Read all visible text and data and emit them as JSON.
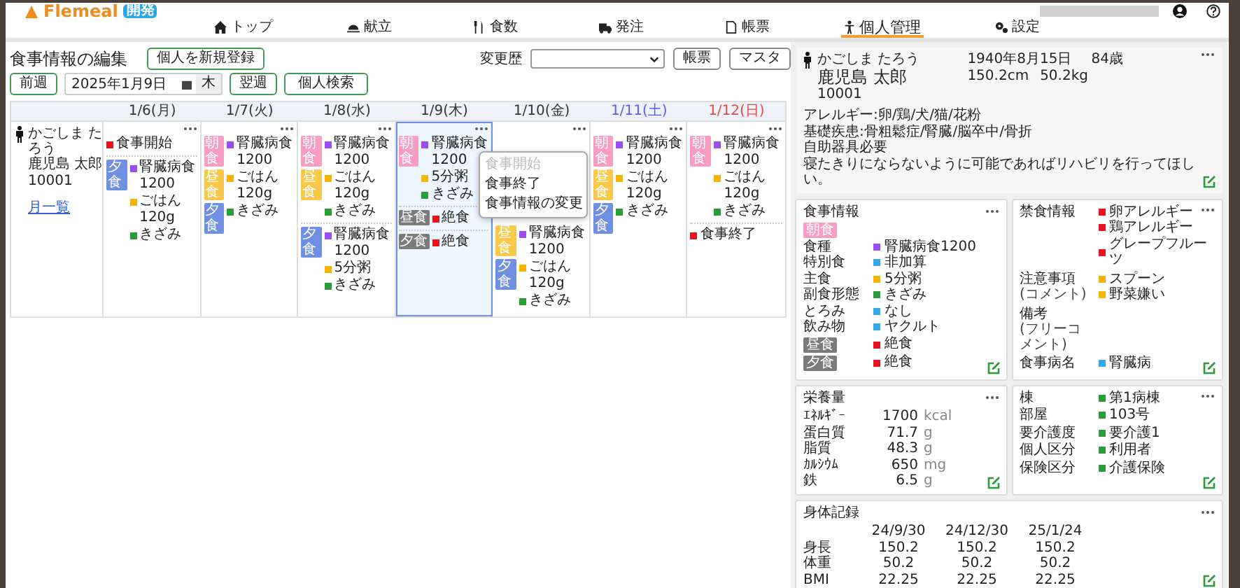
{
  "app": {
    "logo": "Flemeal",
    "env_badge": "開発"
  },
  "nav": [
    {
      "label": "トップ",
      "selected": false
    },
    {
      "label": "献立",
      "selected": false
    },
    {
      "label": "食数",
      "selected": false
    },
    {
      "label": "発注",
      "selected": false
    },
    {
      "label": "帳票",
      "selected": false
    },
    {
      "label": "個人管理",
      "selected": true
    },
    {
      "label": "設定",
      "selected": false
    }
  ],
  "toolbar": {
    "title": "食事情報の編集",
    "register_button": "個人を新規登録",
    "history_label": "変更歴",
    "report_button": "帳票",
    "master_button": "マスタ",
    "prev_week": "前週",
    "date": "2025年1月9日",
    "weekday": "木",
    "next_week": "翌週",
    "search_button": "個人検索"
  },
  "calendar": {
    "person": {
      "kana": "かごしま たろう",
      "name": "鹿児島 太郎",
      "id": "10001",
      "link": "月一覧"
    },
    "days": [
      {
        "date": "1/6(月)",
        "kind": "weekday",
        "selected": false,
        "sections": [
          {
            "items": [
              {
                "text": "食事開始",
                "color": "#e8141e"
              }
            ]
          },
          {
            "badges": [
              {
                "label": "夕食",
                "kind": "dinner"
              }
            ],
            "items": [
              {
                "text": "腎臓病食1200",
                "color": "#9b4df0"
              },
              {
                "text": "ごはん120g",
                "color": "#f5b400"
              },
              {
                "text": "きざみ",
                "color": "#2a9d3a"
              }
            ]
          }
        ]
      },
      {
        "date": "1/7(火)",
        "kind": "weekday",
        "selected": false,
        "sections": [
          {
            "badges": [
              {
                "label": "朝食",
                "kind": "breakfast"
              },
              {
                "label": "昼食",
                "kind": "lunch"
              },
              {
                "label": "夕食",
                "kind": "dinner"
              }
            ],
            "items": [
              {
                "text": "腎臓病食1200",
                "color": "#9b4df0"
              },
              {
                "text": "ごはん120g",
                "color": "#f5b400"
              },
              {
                "text": "きざみ",
                "color": "#2a9d3a"
              }
            ]
          }
        ]
      },
      {
        "date": "1/8(水)",
        "kind": "weekday",
        "selected": false,
        "sections": [
          {
            "badges": [
              {
                "label": "朝食",
                "kind": "breakfast"
              },
              {
                "label": "昼食",
                "kind": "lunch"
              }
            ],
            "items": [
              {
                "text": "腎臓病食1200",
                "color": "#9b4df0"
              },
              {
                "text": "ごはん120g",
                "color": "#f5b400"
              },
              {
                "text": "きざみ",
                "color": "#2a9d3a"
              }
            ]
          },
          {
            "badges": [
              {
                "label": "夕食",
                "kind": "dinner"
              }
            ],
            "items": [
              {
                "text": "腎臓病食1200",
                "color": "#9b4df0"
              },
              {
                "text": "5分粥",
                "color": "#f5b400"
              },
              {
                "text": "きざみ",
                "color": "#2a9d3a"
              }
            ]
          }
        ]
      },
      {
        "date": "1/9(木)",
        "kind": "weekday",
        "selected": true,
        "menu": [
          {
            "label": "食事開始",
            "disabled": true
          },
          {
            "label": "食事終了",
            "disabled": false
          },
          {
            "label": "食事情報の変更",
            "disabled": false
          }
        ],
        "sections": [
          {
            "badges": [
              {
                "label": "朝食",
                "kind": "breakfast"
              }
            ],
            "items": [
              {
                "text": "腎臓病食1200",
                "color": "#9b4df0"
              },
              {
                "text": "5分粥",
                "color": "#f5b400"
              },
              {
                "text": "きざみ",
                "color": "#2a9d3a"
              }
            ]
          },
          {
            "badges": [
              {
                "label": "昼食",
                "kind": "fasting"
              }
            ],
            "items": [
              {
                "text": "絶食",
                "color": "#e8141e"
              }
            ]
          },
          {
            "badges": [
              {
                "label": "夕食",
                "kind": "fasting"
              }
            ],
            "items": [
              {
                "text": "絶食",
                "color": "#e8141e"
              }
            ]
          }
        ]
      },
      {
        "date": "1/10(金)",
        "kind": "weekday",
        "selected": false,
        "sections": [
          {
            "badges": [
              {
                "label": "昼食",
                "kind": "lunch"
              },
              {
                "label": "夕食",
                "kind": "dinner"
              }
            ],
            "items": [
              {
                "text": "腎臓病食1200",
                "color": "#9b4df0"
              },
              {
                "text": "ごはん120g",
                "color": "#f5b400"
              },
              {
                "text": "きざみ",
                "color": "#2a9d3a"
              }
            ]
          }
        ]
      },
      {
        "date": "1/11(土)",
        "kind": "saturday",
        "selected": false,
        "sections": [
          {
            "badges": [
              {
                "label": "朝食",
                "kind": "breakfast"
              },
              {
                "label": "昼食",
                "kind": "lunch"
              },
              {
                "label": "夕食",
                "kind": "dinner"
              }
            ],
            "items": [
              {
                "text": "腎臓病食1200",
                "color": "#9b4df0"
              },
              {
                "text": "ごはん120g",
                "color": "#f5b400"
              },
              {
                "text": "きざみ",
                "color": "#2a9d3a"
              }
            ]
          }
        ]
      },
      {
        "date": "1/12(日)",
        "kind": "sunday",
        "selected": false,
        "sections": [
          {
            "badges": [
              {
                "label": "朝食",
                "kind": "breakfast"
              }
            ],
            "items": [
              {
                "text": "腎臓病食1200",
                "color": "#9b4df0"
              },
              {
                "text": "ごはん120g",
                "color": "#f5b400"
              },
              {
                "text": "きざみ",
                "color": "#2a9d3a"
              }
            ]
          },
          {
            "items": [
              {
                "text": "食事終了",
                "color": "#e8141e"
              }
            ]
          }
        ]
      }
    ]
  },
  "profile": {
    "kana": "かごしま たろう",
    "name": "鹿児島 太郎",
    "id": "10001",
    "birth": "1940年8月15日",
    "age": "84歳",
    "height": "150.2cm",
    "weight": "50.2kg",
    "notes": [
      "アレルギー:卵/鶏/犬/猫/花粉",
      "基礎疾患:骨粗鬆症/腎臓/脳卒中/骨折",
      "自助器具必要",
      "寝たきりにならないように可能であればリハビリを行ってほしい。"
    ]
  },
  "meal_info": {
    "title": "食事情報",
    "badge": {
      "label": "朝食",
      "kind": "breakfast"
    },
    "rows": [
      {
        "label": "食種",
        "value": "腎臓病食1200",
        "color": "#9b4df0"
      },
      {
        "label": "特別食",
        "value": "非加算",
        "color": "#35a9e8"
      },
      {
        "label": "主食",
        "value": "5分粥",
        "color": "#f5b400"
      },
      {
        "label": "副食形態",
        "value": "きざみ",
        "color": "#2a9d3a"
      },
      {
        "label": "とろみ",
        "value": "なし",
        "color": "#35a9e8"
      },
      {
        "label": "飲み物",
        "value": "ヤクルト",
        "color": "#35a9e8"
      }
    ],
    "meal_rows": [
      {
        "badge": {
          "label": "昼食",
          "kind": "fasting"
        },
        "value": "絶食",
        "color": "#e8141e"
      },
      {
        "badge": {
          "label": "夕食",
          "kind": "fasting"
        },
        "value": "絶食",
        "color": "#e8141e"
      }
    ]
  },
  "restrictions": {
    "rows": [
      {
        "label": "禁食情報",
        "values": [
          {
            "text": "卵アレルギー",
            "color": "#e8141e"
          },
          {
            "text": "鶏アレルギー",
            "color": "#e8141e"
          },
          {
            "text": "グレープフルーツ",
            "color": "#e8141e"
          }
        ]
      },
      {
        "label": "注意事項",
        "sublabel": "(コメント)",
        "values": [
          {
            "text": "スプーン",
            "color": "#f5b400"
          },
          {
            "text": "野菜嫌い",
            "color": "#f5b400"
          }
        ]
      },
      {
        "label": "備考",
        "sublabel": "(フリーコメント)"
      },
      {
        "label": "食事病名",
        "values": [
          {
            "text": "腎臓病",
            "color": "#35a9e8"
          }
        ]
      }
    ]
  },
  "nutrition": {
    "title": "栄養量",
    "rows": [
      {
        "label": "ｴﾈﾙｷﾞｰ",
        "value": "1700",
        "unit": "kcal"
      },
      {
        "label": "蛋白質",
        "value": "71.7",
        "unit": "g"
      },
      {
        "label": "脂質",
        "value": "48.3",
        "unit": "g"
      },
      {
        "label": "ｶﾙｼｳﾑ",
        "value": "650",
        "unit": "mg"
      },
      {
        "label": "鉄",
        "value": "6.5",
        "unit": "g"
      }
    ]
  },
  "ward": {
    "rows": [
      {
        "label": "棟",
        "value": "第1病棟",
        "color": "#2a9d3a"
      },
      {
        "label": "部屋",
        "value": "103号",
        "color": "#2a9d3a"
      },
      {
        "label": "要介護度",
        "value": "要介護1",
        "color": "#2a9d3a"
      },
      {
        "label": "個人区分",
        "value": "利用者",
        "color": "#2a9d3a"
      },
      {
        "label": "保険区分",
        "value": "介護保険",
        "color": "#2a9d3a"
      }
    ]
  },
  "body_record": {
    "title": "身体記録",
    "columns": [
      "24/9/30",
      "24/12/30",
      "25/1/24"
    ],
    "rows": [
      {
        "label": "身長",
        "values": [
          "150.2",
          "150.2",
          "150.2"
        ]
      },
      {
        "label": "体重",
        "values": [
          "50.2",
          "50.2",
          "50.2"
        ]
      },
      {
        "label": "BMI",
        "values": [
          "22.25",
          "22.25",
          "22.25"
        ]
      }
    ]
  }
}
